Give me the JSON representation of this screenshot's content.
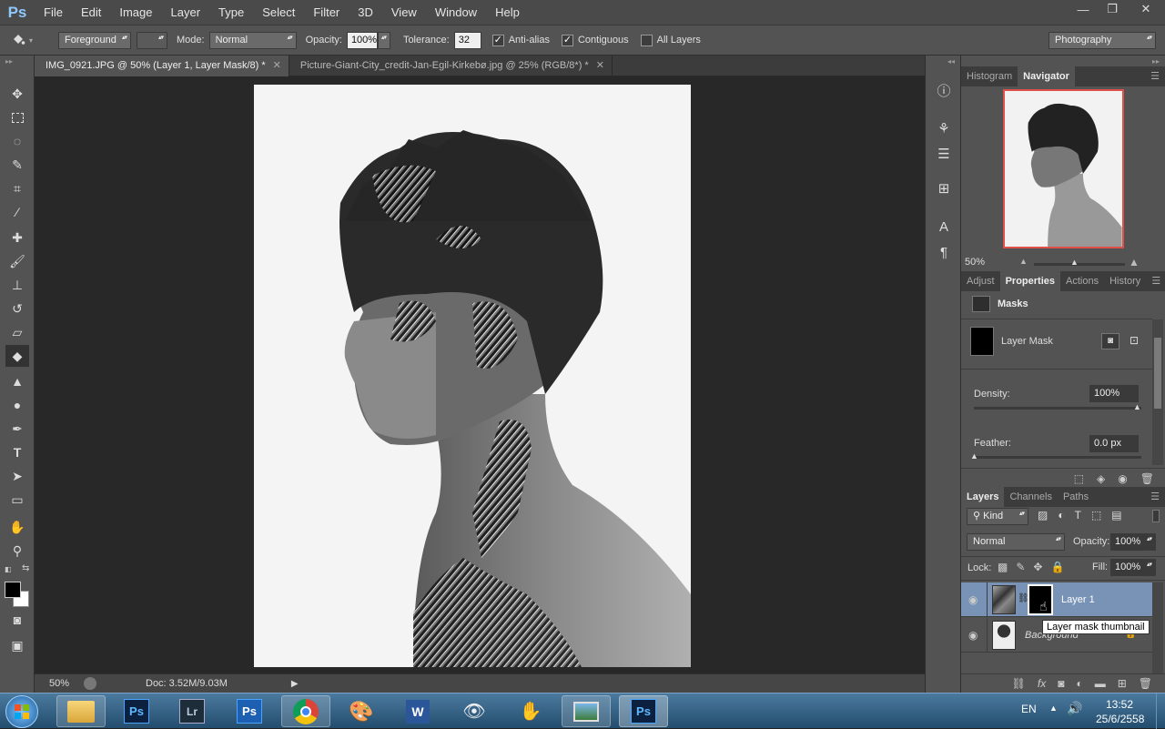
{
  "app": {
    "logo": "Ps"
  },
  "menu": [
    "File",
    "Edit",
    "Image",
    "Layer",
    "Type",
    "Select",
    "Filter",
    "3D",
    "View",
    "Window",
    "Help"
  ],
  "window_controls": [
    "—",
    "❐",
    "✕"
  ],
  "options": {
    "fill_source": "Foreground",
    "mode_label": "Mode:",
    "mode_value": "Normal",
    "opacity_label": "Opacity:",
    "opacity_value": "100%",
    "tolerance_label": "Tolerance:",
    "tolerance_value": "32",
    "antialias_label": "Anti-alias",
    "contiguous_label": "Contiguous",
    "all_layers_label": "All Layers",
    "workspace": "Photography"
  },
  "tabs": [
    {
      "label": "IMG_0921.JPG @ 50% (Layer 1, Layer Mask/8) *",
      "active": true
    },
    {
      "label": "Picture-Giant-City_credit-Jan-Egil-Kirkebø.jpg @ 25% (RGB/8*) *",
      "active": false
    }
  ],
  "status": {
    "zoom": "50%",
    "doc": "Doc: 3.52M/9.03M"
  },
  "navigator": {
    "tabs": [
      "Histogram",
      "Navigator"
    ],
    "zoom": "50%"
  },
  "properties": {
    "tabs": [
      "Adjust",
      "Properties",
      "Actions",
      "History"
    ],
    "header": "Masks",
    "mask_label": "Layer Mask",
    "density_label": "Density:",
    "density_value": "100%",
    "feather_label": "Feather:",
    "feather_value": "0.0 px"
  },
  "layers": {
    "tabs": [
      "Layers",
      "Channels",
      "Paths"
    ],
    "kind": "Kind",
    "blend": "Normal",
    "opacity_label": "Opacity:",
    "opacity_value": "100%",
    "lock_label": "Lock:",
    "fill_label": "Fill:",
    "fill_value": "100%",
    "items": [
      {
        "name": "Layer 1",
        "selected": true
      },
      {
        "name": "Background",
        "selected": false
      }
    ],
    "tooltip": "Layer mask thumbnail"
  },
  "taskbar": {
    "lang": "EN",
    "time": "13:52",
    "date": "25/6/2558"
  }
}
